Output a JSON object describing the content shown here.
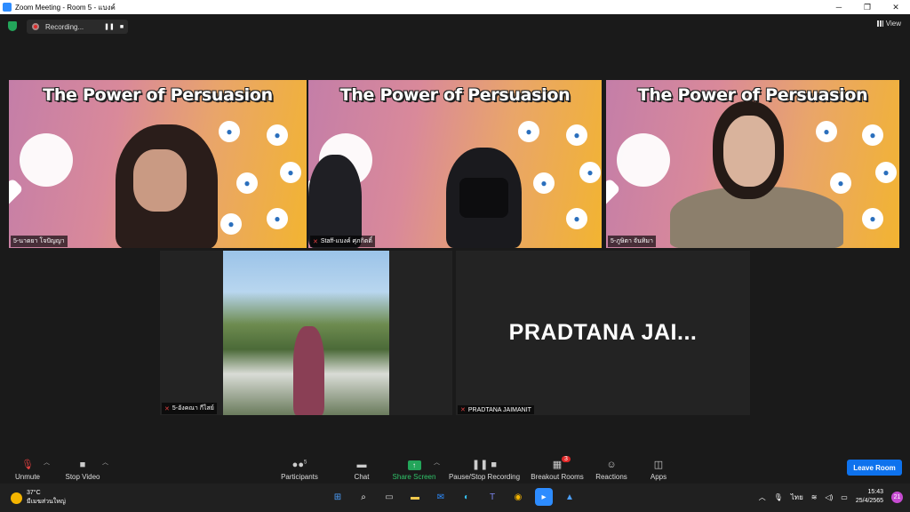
{
  "window": {
    "title": "Zoom Meeting - Room 5 - แบงค์"
  },
  "window_controls": {
    "minimize": "─",
    "restore": "❐",
    "close": "✕"
  },
  "recording": {
    "label": "Recording...",
    "pause": "❚❚",
    "stop": "■"
  },
  "view": {
    "label": "View"
  },
  "slide": {
    "title": "The Power of Persuasion"
  },
  "participants": [
    {
      "name": "5-นาดยา โจปัญญา",
      "muted": false,
      "speaking": true
    },
    {
      "name": "Staff-แบงค์ ศุภกิตติ์",
      "muted": true,
      "speaking": false
    },
    {
      "name": "5-ภูษิตา จันทิมา",
      "muted": false,
      "speaking": false
    },
    {
      "name": "5-อังคณา กีไสย์",
      "muted": true,
      "speaking": false
    },
    {
      "name": "PRADTANA JAIMANIT",
      "muted": true,
      "speaking": false,
      "display_text": "PRADTANA  JAI..."
    }
  ],
  "toolbar": {
    "unmute": "Unmute",
    "stop_video": "Stop Video",
    "participants": "Participants",
    "participants_count": "5",
    "chat": "Chat",
    "share_screen": "Share Screen",
    "pause_stop_recording": "Pause/Stop Recording",
    "breakout_rooms": "Breakout Rooms",
    "breakout_badge": "3",
    "reactions": "Reactions",
    "apps": "Apps",
    "leave_room": "Leave Room"
  },
  "taskbar": {
    "temperature": "37°C",
    "weather": "มีเมฆส่วนใหญ่",
    "language": "ไทย",
    "time": "15:43",
    "date": "25/4/2565",
    "notifications": "21"
  },
  "colors": {
    "speaker_border": "#f0e43c",
    "leave_button": "#0e72ed",
    "share_green": "#23a55a",
    "record_red": "#e02828"
  }
}
